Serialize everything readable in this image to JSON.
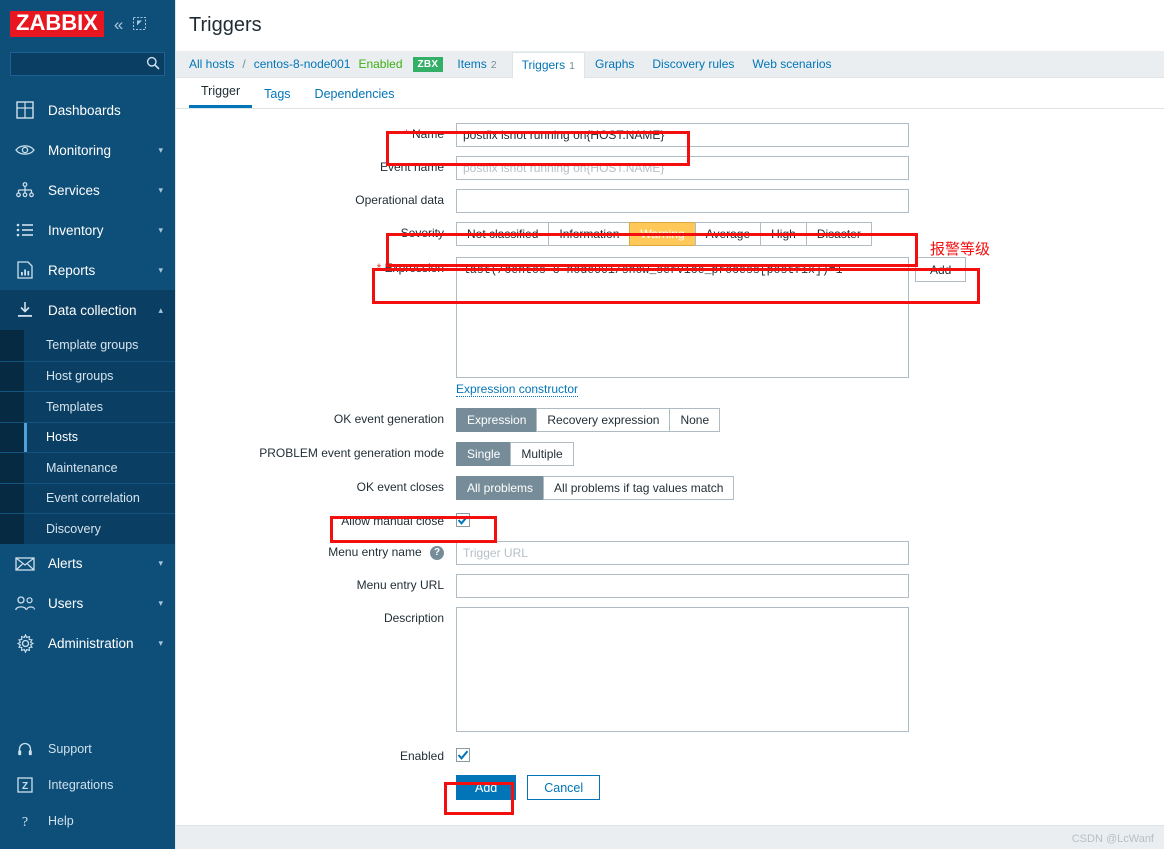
{
  "brand": {
    "logo": "ZABBIX",
    "collapse_icon": "collapse-sidebar-icon",
    "expand_icon": "expand-sidebar-icon"
  },
  "colors": {
    "sidebar_bg": "#0e4f79",
    "logo_red": "#e8161f",
    "accent_blue": "#0275b8",
    "warning_orange": "#ffc859",
    "annotation_red": "#f40f0f",
    "zbx_green": "#34af67",
    "enabled_green": "#3db015"
  },
  "search": {
    "value": "",
    "placeholder": ""
  },
  "sidebar": {
    "items": [
      {
        "label": "Dashboards",
        "icon": "dashboard-icon",
        "has_chevron": false
      },
      {
        "label": "Monitoring",
        "icon": "eye-icon",
        "has_chevron": true
      },
      {
        "label": "Services",
        "icon": "services-tree-icon",
        "has_chevron": true
      },
      {
        "label": "Inventory",
        "icon": "list-icon",
        "has_chevron": true
      },
      {
        "label": "Reports",
        "icon": "report-chart-icon",
        "has_chevron": true
      },
      {
        "label": "Data collection",
        "icon": "download-icon",
        "has_chevron": true,
        "expanded": true
      }
    ],
    "data_collection_sub": [
      {
        "label": "Template groups",
        "selected": false
      },
      {
        "label": "Host groups",
        "selected": false
      },
      {
        "label": "Templates",
        "selected": false
      },
      {
        "label": "Hosts",
        "selected": true
      },
      {
        "label": "Maintenance",
        "selected": false
      },
      {
        "label": "Event correlation",
        "selected": false
      },
      {
        "label": "Discovery",
        "selected": false
      }
    ],
    "items_after": [
      {
        "label": "Alerts",
        "icon": "envelope-icon",
        "has_chevron": true
      },
      {
        "label": "Users",
        "icon": "users-icon",
        "has_chevron": true
      },
      {
        "label": "Administration",
        "icon": "gear-icon",
        "has_chevron": true
      }
    ],
    "bottom_items": [
      {
        "label": "Support",
        "icon": "headset-icon"
      },
      {
        "label": "Integrations",
        "icon": "zabbix-z-icon"
      },
      {
        "label": "Help",
        "icon": "question-mark-icon"
      }
    ]
  },
  "header": {
    "title": "Triggers"
  },
  "breadcrumb": {
    "all_hosts": "All hosts",
    "separator": "/",
    "host": "centos-8-node001",
    "status": "Enabled",
    "agent_badge": "ZBX",
    "tabs": [
      {
        "label": "Items",
        "count": "2",
        "current": false
      },
      {
        "label": "Triggers",
        "count": "1",
        "current": true
      },
      {
        "label": "Graphs",
        "count": "",
        "current": false
      },
      {
        "label": "Discovery rules",
        "count": "",
        "current": false
      },
      {
        "label": "Web scenarios",
        "count": "",
        "current": false
      }
    ]
  },
  "form_tabs": [
    {
      "label": "Trigger",
      "selected": true
    },
    {
      "label": "Tags",
      "selected": false
    },
    {
      "label": "Dependencies",
      "selected": false
    }
  ],
  "form": {
    "name": {
      "label": "Name",
      "required": true,
      "value": "postfix isnot running on{HOST.NAME}",
      "placeholder": ""
    },
    "event_name": {
      "label": "Event name",
      "value": "",
      "placeholder": "postfix isnot running on{HOST.NAME}"
    },
    "operational_data": {
      "label": "Operational data",
      "value": "",
      "placeholder": ""
    },
    "severity": {
      "label": "Severity",
      "options": [
        "Not classified",
        "Information",
        "Warning",
        "Average",
        "High",
        "Disaster"
      ],
      "selected": "Warning"
    },
    "expression": {
      "label": "Expression",
      "required": true,
      "value": "last(/centos-8-node001/show_service_process[postfix])=1",
      "add_button": "Add",
      "constructor_link": "Expression constructor"
    },
    "ok_event_generation": {
      "label": "OK event generation",
      "options": [
        "Expression",
        "Recovery expression",
        "None"
      ],
      "selected": "Expression"
    },
    "problem_event_generation_mode": {
      "label": "PROBLEM event generation mode",
      "options": [
        "Single",
        "Multiple"
      ],
      "selected": "Single"
    },
    "ok_event_closes": {
      "label": "OK event closes",
      "options": [
        "All problems",
        "All problems if tag values match"
      ],
      "selected": "All problems"
    },
    "allow_manual_close": {
      "label": "Allow manual close",
      "checked": true
    },
    "menu_entry_name": {
      "label": "Menu entry name",
      "help": "?",
      "value": "",
      "placeholder": "Trigger URL"
    },
    "menu_entry_url": {
      "label": "Menu entry URL",
      "value": "",
      "placeholder": ""
    },
    "description": {
      "label": "Description",
      "value": "",
      "placeholder": ""
    },
    "enabled": {
      "label": "Enabled",
      "checked": true
    },
    "submit_button": "Add",
    "cancel_button": "Cancel"
  },
  "annotations": {
    "severity_note": "报警等级"
  },
  "watermark": "CSDN @LcWanf"
}
